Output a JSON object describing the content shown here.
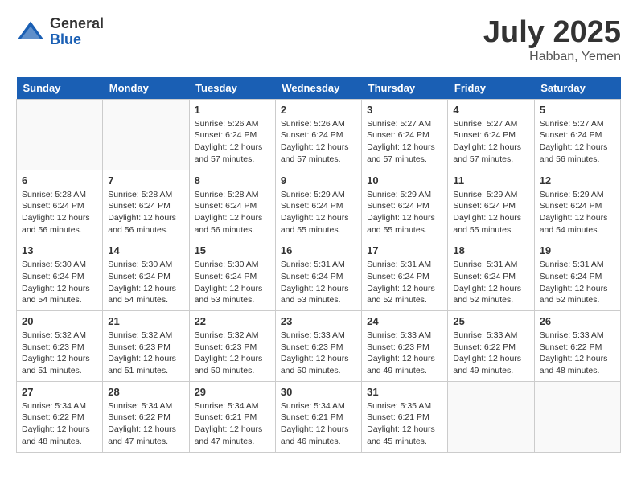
{
  "logo": {
    "general": "General",
    "blue": "Blue"
  },
  "title": {
    "month_year": "July 2025",
    "location": "Habban, Yemen"
  },
  "headers": [
    "Sunday",
    "Monday",
    "Tuesday",
    "Wednesday",
    "Thursday",
    "Friday",
    "Saturday"
  ],
  "weeks": [
    [
      {
        "day": "",
        "sunrise": "",
        "sunset": "",
        "daylight": ""
      },
      {
        "day": "",
        "sunrise": "",
        "sunset": "",
        "daylight": ""
      },
      {
        "day": "1",
        "sunrise": "Sunrise: 5:26 AM",
        "sunset": "Sunset: 6:24 PM",
        "daylight": "Daylight: 12 hours and 57 minutes."
      },
      {
        "day": "2",
        "sunrise": "Sunrise: 5:26 AM",
        "sunset": "Sunset: 6:24 PM",
        "daylight": "Daylight: 12 hours and 57 minutes."
      },
      {
        "day": "3",
        "sunrise": "Sunrise: 5:27 AM",
        "sunset": "Sunset: 6:24 PM",
        "daylight": "Daylight: 12 hours and 57 minutes."
      },
      {
        "day": "4",
        "sunrise": "Sunrise: 5:27 AM",
        "sunset": "Sunset: 6:24 PM",
        "daylight": "Daylight: 12 hours and 57 minutes."
      },
      {
        "day": "5",
        "sunrise": "Sunrise: 5:27 AM",
        "sunset": "Sunset: 6:24 PM",
        "daylight": "Daylight: 12 hours and 56 minutes."
      }
    ],
    [
      {
        "day": "6",
        "sunrise": "Sunrise: 5:28 AM",
        "sunset": "Sunset: 6:24 PM",
        "daylight": "Daylight: 12 hours and 56 minutes."
      },
      {
        "day": "7",
        "sunrise": "Sunrise: 5:28 AM",
        "sunset": "Sunset: 6:24 PM",
        "daylight": "Daylight: 12 hours and 56 minutes."
      },
      {
        "day": "8",
        "sunrise": "Sunrise: 5:28 AM",
        "sunset": "Sunset: 6:24 PM",
        "daylight": "Daylight: 12 hours and 56 minutes."
      },
      {
        "day": "9",
        "sunrise": "Sunrise: 5:29 AM",
        "sunset": "Sunset: 6:24 PM",
        "daylight": "Daylight: 12 hours and 55 minutes."
      },
      {
        "day": "10",
        "sunrise": "Sunrise: 5:29 AM",
        "sunset": "Sunset: 6:24 PM",
        "daylight": "Daylight: 12 hours and 55 minutes."
      },
      {
        "day": "11",
        "sunrise": "Sunrise: 5:29 AM",
        "sunset": "Sunset: 6:24 PM",
        "daylight": "Daylight: 12 hours and 55 minutes."
      },
      {
        "day": "12",
        "sunrise": "Sunrise: 5:29 AM",
        "sunset": "Sunset: 6:24 PM",
        "daylight": "Daylight: 12 hours and 54 minutes."
      }
    ],
    [
      {
        "day": "13",
        "sunrise": "Sunrise: 5:30 AM",
        "sunset": "Sunset: 6:24 PM",
        "daylight": "Daylight: 12 hours and 54 minutes."
      },
      {
        "day": "14",
        "sunrise": "Sunrise: 5:30 AM",
        "sunset": "Sunset: 6:24 PM",
        "daylight": "Daylight: 12 hours and 54 minutes."
      },
      {
        "day": "15",
        "sunrise": "Sunrise: 5:30 AM",
        "sunset": "Sunset: 6:24 PM",
        "daylight": "Daylight: 12 hours and 53 minutes."
      },
      {
        "day": "16",
        "sunrise": "Sunrise: 5:31 AM",
        "sunset": "Sunset: 6:24 PM",
        "daylight": "Daylight: 12 hours and 53 minutes."
      },
      {
        "day": "17",
        "sunrise": "Sunrise: 5:31 AM",
        "sunset": "Sunset: 6:24 PM",
        "daylight": "Daylight: 12 hours and 52 minutes."
      },
      {
        "day": "18",
        "sunrise": "Sunrise: 5:31 AM",
        "sunset": "Sunset: 6:24 PM",
        "daylight": "Daylight: 12 hours and 52 minutes."
      },
      {
        "day": "19",
        "sunrise": "Sunrise: 5:31 AM",
        "sunset": "Sunset: 6:24 PM",
        "daylight": "Daylight: 12 hours and 52 minutes."
      }
    ],
    [
      {
        "day": "20",
        "sunrise": "Sunrise: 5:32 AM",
        "sunset": "Sunset: 6:23 PM",
        "daylight": "Daylight: 12 hours and 51 minutes."
      },
      {
        "day": "21",
        "sunrise": "Sunrise: 5:32 AM",
        "sunset": "Sunset: 6:23 PM",
        "daylight": "Daylight: 12 hours and 51 minutes."
      },
      {
        "day": "22",
        "sunrise": "Sunrise: 5:32 AM",
        "sunset": "Sunset: 6:23 PM",
        "daylight": "Daylight: 12 hours and 50 minutes."
      },
      {
        "day": "23",
        "sunrise": "Sunrise: 5:33 AM",
        "sunset": "Sunset: 6:23 PM",
        "daylight": "Daylight: 12 hours and 50 minutes."
      },
      {
        "day": "24",
        "sunrise": "Sunrise: 5:33 AM",
        "sunset": "Sunset: 6:23 PM",
        "daylight": "Daylight: 12 hours and 49 minutes."
      },
      {
        "day": "25",
        "sunrise": "Sunrise: 5:33 AM",
        "sunset": "Sunset: 6:22 PM",
        "daylight": "Daylight: 12 hours and 49 minutes."
      },
      {
        "day": "26",
        "sunrise": "Sunrise: 5:33 AM",
        "sunset": "Sunset: 6:22 PM",
        "daylight": "Daylight: 12 hours and 48 minutes."
      }
    ],
    [
      {
        "day": "27",
        "sunrise": "Sunrise: 5:34 AM",
        "sunset": "Sunset: 6:22 PM",
        "daylight": "Daylight: 12 hours and 48 minutes."
      },
      {
        "day": "28",
        "sunrise": "Sunrise: 5:34 AM",
        "sunset": "Sunset: 6:22 PM",
        "daylight": "Daylight: 12 hours and 47 minutes."
      },
      {
        "day": "29",
        "sunrise": "Sunrise: 5:34 AM",
        "sunset": "Sunset: 6:21 PM",
        "daylight": "Daylight: 12 hours and 47 minutes."
      },
      {
        "day": "30",
        "sunrise": "Sunrise: 5:34 AM",
        "sunset": "Sunset: 6:21 PM",
        "daylight": "Daylight: 12 hours and 46 minutes."
      },
      {
        "day": "31",
        "sunrise": "Sunrise: 5:35 AM",
        "sunset": "Sunset: 6:21 PM",
        "daylight": "Daylight: 12 hours and 45 minutes."
      },
      {
        "day": "",
        "sunrise": "",
        "sunset": "",
        "daylight": ""
      },
      {
        "day": "",
        "sunrise": "",
        "sunset": "",
        "daylight": ""
      }
    ]
  ]
}
